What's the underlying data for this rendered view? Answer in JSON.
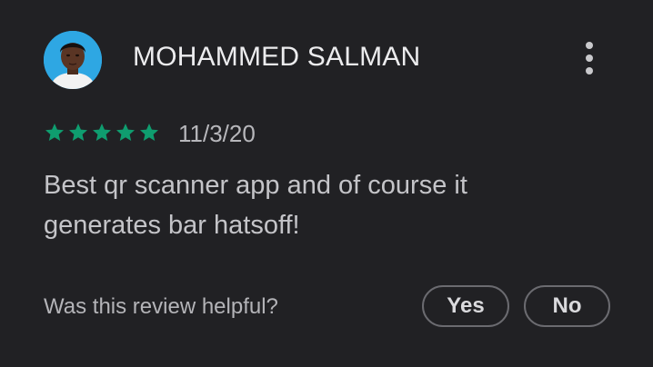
{
  "review": {
    "reviewer_name": "MOHAMMED SALMAN",
    "rating": 5,
    "max_rating": 5,
    "date": "11/3/20",
    "text": "Best qr scanner app and of course it generates bar hatsoff!"
  },
  "helpful": {
    "question": "Was this review helpful?",
    "yes_label": "Yes",
    "no_label": "No"
  },
  "icons": {
    "more": "more-vert-icon",
    "star": "star-icon",
    "avatar": "profile-photo"
  },
  "colors": {
    "background": "#212124",
    "star": "#0f9d6f",
    "avatar_background": "#2ea7e3",
    "pill_border": "#6b6b70"
  }
}
